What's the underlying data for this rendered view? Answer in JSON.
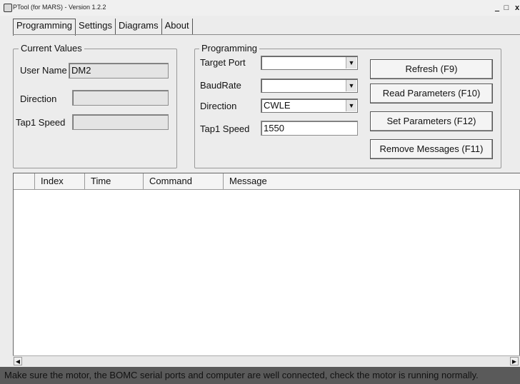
{
  "window": {
    "title": "PTool (for MARS) - Version 1.2.2",
    "min_glyph": "_",
    "max_glyph": "□",
    "close_glyph": "x"
  },
  "tabs": [
    {
      "label": "Programming"
    },
    {
      "label": "Settings"
    },
    {
      "label": "Diagrams"
    },
    {
      "label": "About"
    }
  ],
  "current_values": {
    "title": "Current Values",
    "user_name_label": "User Name",
    "user_name_value": "DM2",
    "direction_label": "Direction",
    "direction_value": "",
    "tap1_speed_label": "Tap1 Speed",
    "tap1_speed_value": ""
  },
  "programming": {
    "title": "Programming",
    "target_port_label": "Target Port",
    "target_port_value": "",
    "baudrate_label": "BaudRate",
    "baudrate_value": "",
    "direction_label": "Direction",
    "direction_value": "CWLE",
    "tap1_speed_label": "Tap1 Speed",
    "tap1_speed_value": "1550"
  },
  "buttons": {
    "refresh": "Refresh (F9)",
    "read": "Read Parameters (F10)",
    "set": "Set Parameters (F12)",
    "remove": "Remove Messages (F11)"
  },
  "log": {
    "columns": [
      "Index",
      "Time",
      "Command",
      "Message"
    ],
    "rows": []
  },
  "scroll": {
    "left_glyph": "◀",
    "right_glyph": "▶"
  },
  "status": "Make sure the motor, the BOMC serial ports and computer are well connected, check the motor is running normally."
}
